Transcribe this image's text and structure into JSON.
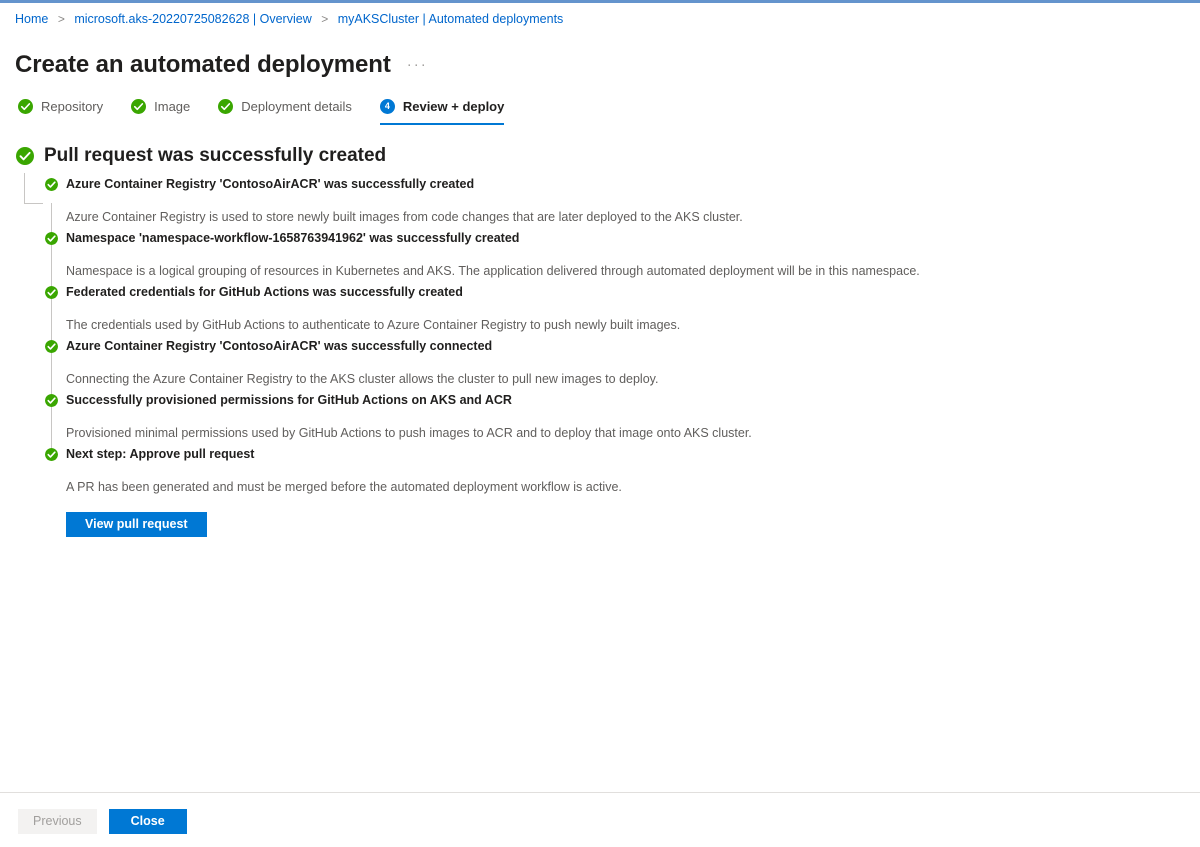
{
  "theme": {
    "accent_blue": "#0078d4",
    "top_bar_blue": "#6494cd",
    "success_green": "#3aa601",
    "link_blue": "#0066cc",
    "text_primary": "#201f1e",
    "text_secondary": "#605e5c",
    "tree_line": "#c8c6c4"
  },
  "breadcrumb": {
    "separator": ">",
    "items": [
      {
        "label": "Home"
      },
      {
        "label": "microsoft.aks-20220725082628 | Overview"
      },
      {
        "label": "myAKSCluster | Automated deployments"
      }
    ]
  },
  "header": {
    "title": "Create an automated deployment",
    "more_menu": "···"
  },
  "wizard": {
    "tabs": [
      {
        "label": "Repository",
        "state": "complete",
        "badge": "check"
      },
      {
        "label": "Image",
        "state": "complete",
        "badge": "check"
      },
      {
        "label": "Deployment details",
        "state": "complete",
        "badge": "check"
      },
      {
        "label": "Review + deploy",
        "state": "active",
        "badge": "4"
      }
    ]
  },
  "result": {
    "heading": "Pull request was successfully created",
    "nodes": [
      {
        "title": "Azure Container Registry 'ContosoAirACR' was successfully created",
        "description": "Azure Container Registry is used to store newly built images from code changes that are later deployed to the AKS cluster."
      },
      {
        "title": "Namespace 'namespace-workflow-1658763941962' was successfully created",
        "description": "Namespace is a logical grouping of resources in Kubernetes and AKS. The application delivered through automated deployment will be in this namespace."
      },
      {
        "title": "Federated credentials for GitHub Actions was successfully created",
        "description": "The credentials used by GitHub Actions to authenticate to Azure Container Registry to push newly built images."
      },
      {
        "title": "Azure Container Registry 'ContosoAirACR' was successfully connected",
        "description": "Connecting the Azure Container Registry to the AKS cluster allows the cluster to pull new images to deploy."
      },
      {
        "title": "Successfully provisioned permissions for GitHub Actions on AKS and ACR",
        "description": "Provisioned minimal permissions used by GitHub Actions to push images to ACR and to deploy that image onto AKS cluster."
      },
      {
        "title": "Next step: Approve pull request",
        "description": "A PR has been generated and must be merged before the automated deployment workflow is active.",
        "action_label": "View pull request"
      }
    ]
  },
  "footer": {
    "previous_label": "Previous",
    "close_label": "Close"
  }
}
